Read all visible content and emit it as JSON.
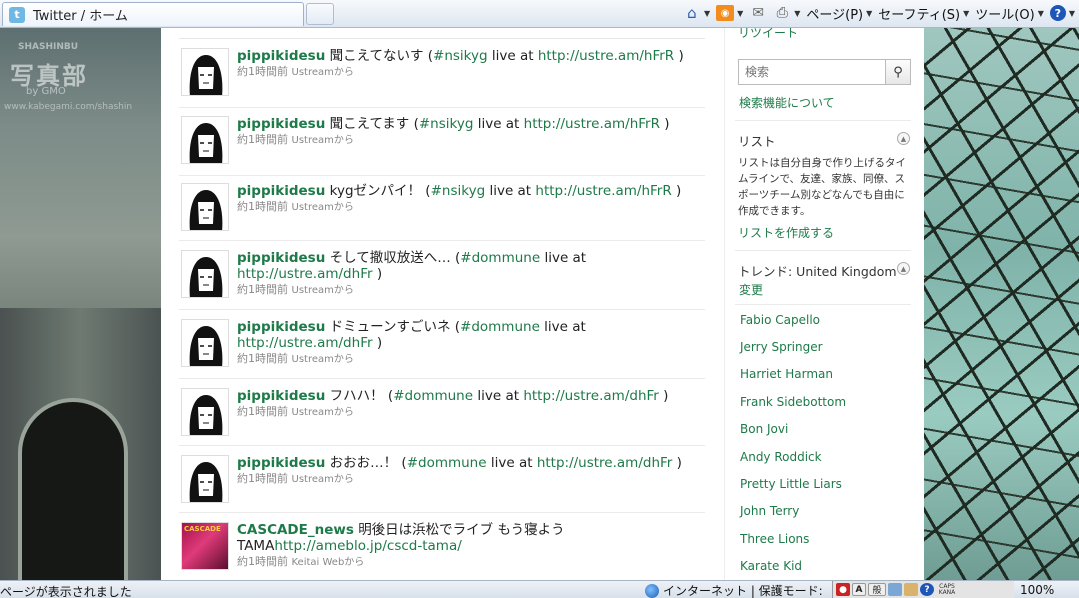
{
  "browser": {
    "tab_title": "Twitter / ホーム",
    "tools": {
      "page": "ページ(P)",
      "safety": "セーフティ(S)",
      "tool": "ツール(O)"
    }
  },
  "wallpaper": {
    "watermark_top": "SHASHINBU",
    "watermark_main": "写真部",
    "watermark_gmo": "by GMO",
    "watermark_url": "www.kabegami.com/shashin"
  },
  "timeline": [
    {
      "user": "pippikidesu",
      "text": "聞こえてないす (",
      "hashtag": "#nsikyg",
      "mid": " live at ",
      "url": "http://ustre.am/hFrR",
      "end": " )",
      "time": "約1時間前",
      "source": "Ustreamから"
    },
    {
      "user": "pippikidesu",
      "text": "聞こえてます (",
      "hashtag": "#nsikyg",
      "mid": " live at ",
      "url": "http://ustre.am/hFrR",
      "end": " )",
      "time": "約1時間前",
      "source": "Ustreamから"
    },
    {
      "user": "pippikidesu",
      "text": "kygゼンパイ！ (",
      "hashtag": "#nsikyg",
      "mid": " live at ",
      "url": "http://ustre.am/hFrR",
      "end": " )",
      "time": "約1時間前",
      "source": "Ustreamから"
    },
    {
      "user": "pippikidesu",
      "text": "そして撤収放送へ… (",
      "hashtag": "#dommune",
      "mid": " live at ",
      "url": "http://ustre.am/dhFr",
      "end": " )",
      "time": "約1時間前",
      "source": "Ustreamから"
    },
    {
      "user": "pippikidesu",
      "text": "ドミューンすごいネ (",
      "hashtag": "#dommune",
      "mid": " live at ",
      "url": "http://ustre.am/dhFr",
      "end": " )",
      "time": "約1時間前",
      "source": "Ustreamから"
    },
    {
      "user": "pippikidesu",
      "text": "フハハ！ (",
      "hashtag": "#dommune",
      "mid": " live at ",
      "url": "http://ustre.am/dhFr",
      "end": " )",
      "time": "約1時間前",
      "source": "Ustreamから"
    },
    {
      "user": "pippikidesu",
      "text": "おおお…！ (",
      "hashtag": "#dommune",
      "mid": " live at ",
      "url": "http://ustre.am/dhFr",
      "end": " )",
      "time": "約1時間前",
      "source": "Ustreamから"
    },
    {
      "user": "CASCADE_news",
      "text": "明後日は浜松でライブ もう寝よう TAMA",
      "hashtag": "",
      "mid": "",
      "url": "http://ameblo.jp/cscd-tama/",
      "end": "",
      "time": "約1時間前",
      "source": "Keitai Webから",
      "avatar_label": "CASCADE"
    }
  ],
  "sidebar": {
    "retweet_link": "リツイート",
    "search_placeholder": "検索",
    "advanced_search": "検索機能について",
    "lists_heading": "リスト",
    "lists_desc": "リストは自分自身で作り上げるタイムラインで、友達、家族、同僚、スポーツチーム別などなんでも自由に作成できます。",
    "make_list": "リストを作成する",
    "trends_heading": "トレンド: United Kingdom",
    "trends_change": "変更",
    "trends": [
      "Fabio Capello",
      "Jerry Springer",
      "Harriet Harman",
      "Frank Sidebottom",
      "Bon Jovi",
      "Andy Roddick",
      "Pretty Little Liars",
      "John Terry",
      "Three Lions",
      "Karate Kid"
    ]
  },
  "status_bar": {
    "text": "ページが表示されました",
    "zone": "インターネット | 保護モード:",
    "tray_a": "A",
    "tray_mode": "般",
    "caps": "CAPS",
    "kana": "KANA",
    "zoom": "100%"
  },
  "colors": {
    "link_green": "#1e7a49",
    "text": "#222222",
    "meta": "#888888"
  }
}
